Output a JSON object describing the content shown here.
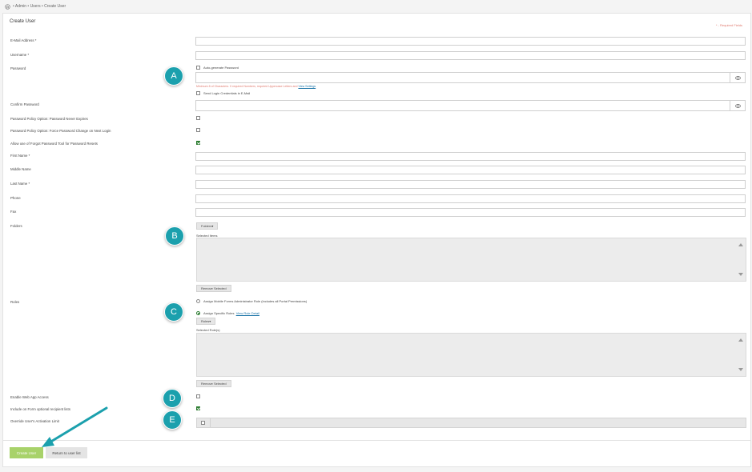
{
  "breadcrumb": {
    "home_icon": "home-icon",
    "text": "• Admin • Users • Create User"
  },
  "panel": {
    "title": "Create User",
    "required_note": "* - Required Fields"
  },
  "fields": {
    "email_label": "E-Mail Address *",
    "username_label": "Username *",
    "password_label": "Password",
    "auto_generate_label": "Auto-generate Password",
    "password_hint": "Minimum 8 of Characters. 0 required Numbers, required Uppercase Letters and",
    "password_hint_link": "View Settings",
    "send_login_label": "Send Login Credentials in E-Mail",
    "confirm_password_label": "Confirm Password",
    "never_expires_label": "Password Policy Option: Password Never Expires",
    "force_change_label": "Password Policy Option: Force Password Change on Next Login",
    "forgot_tool_label": "Allow use of Forgot Password Tool for Password Resets",
    "first_name_label": "First Name *",
    "middle_name_label": "Middle Name",
    "last_name_label": "Last Name *",
    "phone_label": "Phone",
    "fax_label": "Fax",
    "folders_label": "Folders",
    "folders_select": "Folders",
    "selected_items_label": "Selected Items",
    "remove_selected_1": "Remove Selected",
    "roles_label": "Roles",
    "role_admin_label": "Assign Mobile Forms Administrator Role (includes all Portal Permissions)",
    "role_specific_label": "Assign Specific Roles",
    "role_detail_link": "View Role Detail",
    "roles_select": "Roles",
    "selected_roles_label": "Selected Role(s)",
    "remove_selected_2": "Remove Selected",
    "web_app_label": "Enable Web App Access",
    "optional_recipient_label": "Include on Form optional recipient lists",
    "override_label": "Override User's Activation Limit"
  },
  "buttons": {
    "create": "Create User",
    "return": "Return to user list"
  },
  "callouts": [
    "A",
    "B",
    "C",
    "D",
    "E"
  ],
  "colors": {
    "accent_green": "#a8d26a",
    "checked_green": "#2e7d32",
    "callout_teal": "#1ba0ad",
    "hint_red": "#e07a6f"
  }
}
